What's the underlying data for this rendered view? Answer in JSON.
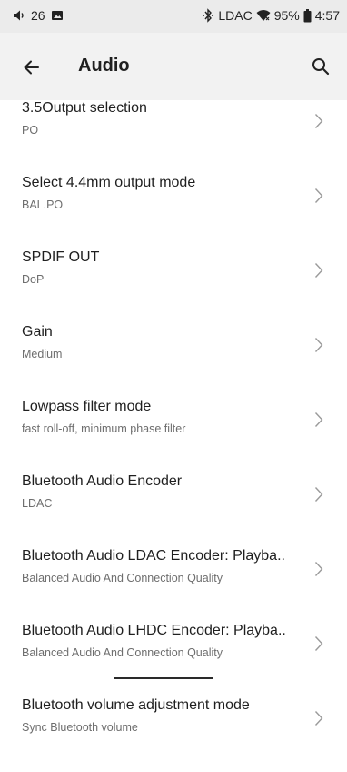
{
  "status_bar": {
    "notification_count": "26",
    "codec": "LDAC",
    "battery": "95%",
    "time": "4:57"
  },
  "app_bar": {
    "title": "Audio"
  },
  "items": [
    {
      "title": "3.5Output selection",
      "subtitle": "PO"
    },
    {
      "title": "Select 4.4mm output mode",
      "subtitle": "BAL.PO"
    },
    {
      "title": "SPDIF OUT",
      "subtitle": "DoP"
    },
    {
      "title": "Gain",
      "subtitle": "Medium"
    },
    {
      "title": "Lowpass filter mode",
      "subtitle": "fast roll-off, minimum phase filter"
    },
    {
      "title": "Bluetooth Audio Encoder",
      "subtitle": "LDAC"
    },
    {
      "title": "Bluetooth Audio LDAC Encoder: Playba..",
      "subtitle": "Balanced Audio And Connection Quality"
    },
    {
      "title": "Bluetooth Audio LHDC Encoder: Playba..",
      "subtitle": "Balanced Audio And Connection Quality"
    },
    {
      "title": "Bluetooth volume adjustment mode",
      "subtitle": "Sync Bluetooth volume"
    }
  ]
}
